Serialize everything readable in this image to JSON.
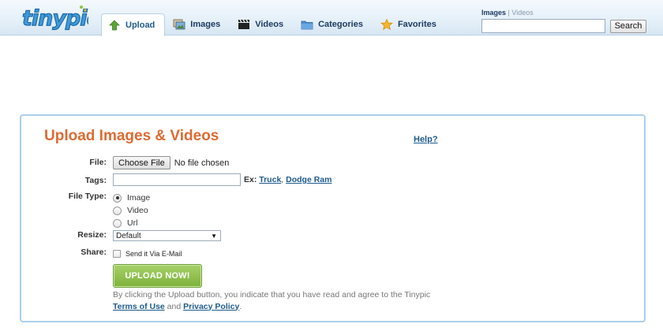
{
  "header": {
    "logo_text": "tinypic",
    "tabs": [
      {
        "label": "Upload",
        "icon": "upload-arrow-icon",
        "active": true
      },
      {
        "label": "Images",
        "icon": "images-icon",
        "active": false
      },
      {
        "label": "Videos",
        "icon": "film-clapper-icon",
        "active": false
      },
      {
        "label": "Categories",
        "icon": "folder-icon",
        "active": false
      },
      {
        "label": "Favorites",
        "icon": "star-icon",
        "active": false
      }
    ],
    "search": {
      "toggle_selected": "Images",
      "toggle_separator": "|",
      "toggle_other": "Videos",
      "input_value": "",
      "button_label": "Search"
    }
  },
  "upload": {
    "title": "Upload Images & Videos",
    "help_label": "Help?",
    "file_label": "File:",
    "choose_file_label": "Choose File",
    "no_file_text": "No file chosen",
    "tags_label": "Tags:",
    "tags_value": "",
    "tags_example_prefix": "Ex:",
    "tags_example_1": "Truck",
    "tags_example_sep": ",",
    "tags_example_2": "Dodge Ram",
    "file_type_label": "File Type:",
    "file_types": [
      {
        "label": "Image",
        "selected": true
      },
      {
        "label": "Video",
        "selected": false
      },
      {
        "label": "Url",
        "selected": false
      }
    ],
    "resize_label": "Resize:",
    "resize_value": "Default",
    "share_label": "Share:",
    "share_option": "Send it Via E-Mail",
    "share_checked": false,
    "upload_button": "UPLOAD NOW!",
    "agree_text": "By clicking the Upload button, you indicate that you have read and agree to the Tinypic",
    "terms_label": "Terms of Use",
    "and_text": "and",
    "privacy_label": "Privacy Policy",
    "period": "."
  },
  "colors": {
    "title": "#dd6b33",
    "link": "#1d5b8c",
    "panel_border": "#a9d0ee",
    "upload_button": "#8fc04d",
    "logo_blue": "#3f9ad9"
  }
}
